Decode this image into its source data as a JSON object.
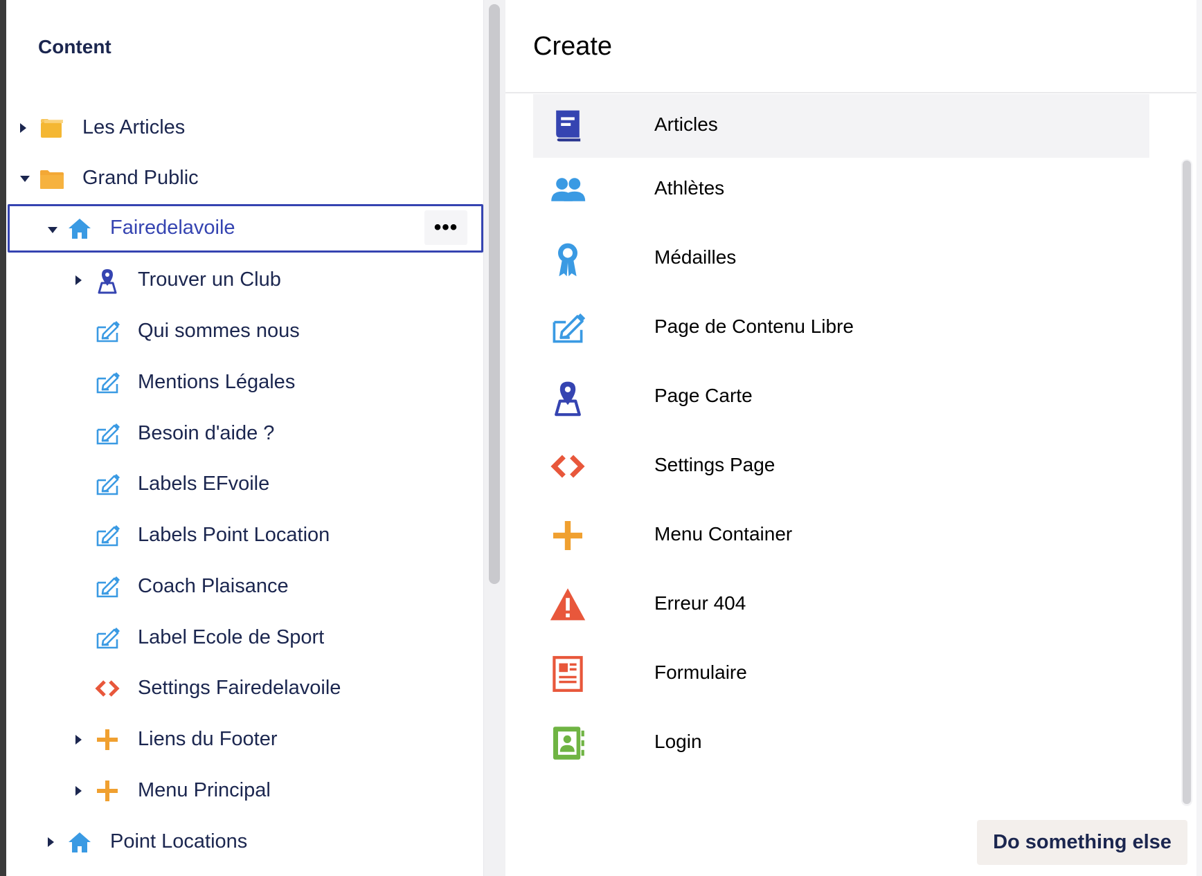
{
  "tree": {
    "title": "Content",
    "items": [
      {
        "label": "Les Articles",
        "icon": "folder-icon",
        "expanded": false,
        "has_children": true,
        "selected": false
      },
      {
        "label": "Grand Public",
        "icon": "folder-open-icon",
        "expanded": true,
        "has_children": true,
        "selected": false
      },
      {
        "label": "Fairedelavoile",
        "icon": "home-icon",
        "expanded": true,
        "has_children": true,
        "selected": true
      },
      {
        "label": "Trouver un Club",
        "icon": "map-pin-icon",
        "expanded": false,
        "has_children": true,
        "selected": false
      },
      {
        "label": "Qui sommes nous",
        "icon": "edit-page-icon",
        "has_children": false,
        "selected": false
      },
      {
        "label": "Mentions Légales",
        "icon": "edit-page-icon",
        "has_children": false,
        "selected": false
      },
      {
        "label": "Besoin d'aide ?",
        "icon": "edit-page-icon",
        "has_children": false,
        "selected": false
      },
      {
        "label": "Labels EFvoile",
        "icon": "edit-page-icon",
        "has_children": false,
        "selected": false
      },
      {
        "label": "Labels Point Location",
        "icon": "edit-page-icon",
        "has_children": false,
        "selected": false
      },
      {
        "label": "Coach Plaisance",
        "icon": "edit-page-icon",
        "has_children": false,
        "selected": false
      },
      {
        "label": "Label Ecole de Sport",
        "icon": "edit-page-icon",
        "has_children": false,
        "selected": false
      },
      {
        "label": "Settings Fairedelavoile",
        "icon": "code-icon",
        "has_children": false,
        "selected": false
      },
      {
        "label": "Liens du Footer",
        "icon": "plus-icon",
        "expanded": false,
        "has_children": true,
        "selected": false
      },
      {
        "label": "Menu Principal",
        "icon": "plus-icon",
        "expanded": false,
        "has_children": true,
        "selected": false
      },
      {
        "label": "Point Locations",
        "icon": "home-icon",
        "expanded": false,
        "has_children": true,
        "selected": false
      }
    ],
    "actions_label": "•••"
  },
  "create": {
    "title": "Create",
    "items": [
      {
        "label": "Articles",
        "icon": "book-icon"
      },
      {
        "label": "Athlètes",
        "icon": "users-icon"
      },
      {
        "label": "Médailles",
        "icon": "medal-icon"
      },
      {
        "label": "Page de Contenu Libre",
        "icon": "edit-page-icon"
      },
      {
        "label": "Page Carte",
        "icon": "map-pin-icon"
      },
      {
        "label": "Settings Page",
        "icon": "code-icon"
      },
      {
        "label": "Menu Container",
        "icon": "plus-icon"
      },
      {
        "label": "Erreur 404",
        "icon": "warning-icon"
      },
      {
        "label": "Formulaire",
        "icon": "form-icon"
      },
      {
        "label": "Login",
        "icon": "contact-book-icon"
      }
    ],
    "highlighted_index": 0,
    "secondary_button": "Do something else"
  },
  "colors": {
    "text": "#1b264f",
    "selection_border": "#3544b1",
    "folder": "#f4b733",
    "blue_icon": "#3a9ae3",
    "indigo_icon": "#3544b1",
    "orange_icon": "#f0a030",
    "red_icon": "#e8573b"
  }
}
